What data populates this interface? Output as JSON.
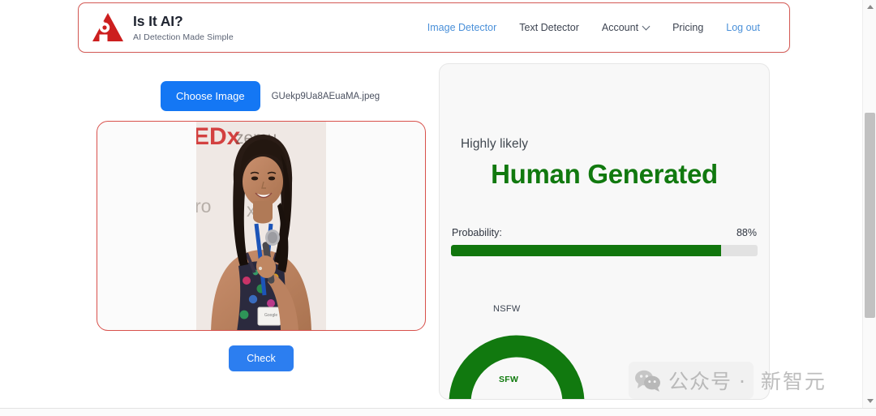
{
  "header": {
    "brand_title": "Is It AI?",
    "brand_tagline": "AI Detection Made Simple",
    "logo_icon": "red-triangle-robot-logo",
    "border_color": "#d45a55",
    "nav": [
      {
        "label": "Image Detector",
        "active": true,
        "icon": ""
      },
      {
        "label": "Text Detector",
        "active": false,
        "icon": ""
      },
      {
        "label": "Account",
        "active": false,
        "icon": "chevron-down-icon"
      },
      {
        "label": "Pricing",
        "active": false,
        "icon": ""
      },
      {
        "label": "Log out",
        "active": true,
        "icon": ""
      }
    ]
  },
  "upload": {
    "choose_button_label": "Choose Image",
    "file_name": "GUekp9Ua8AEuaMA.jpeg",
    "check_button_label": "Check",
    "preview_alt": "Smiling woman holding a microphone on a TEDx stage",
    "preview_border_color": "#d8504b",
    "button_color": "#1477f4"
  },
  "result": {
    "likelihood_text": "Highly likely",
    "verdict": "Human Generated",
    "verdict_color": "#11790f",
    "probability_label": "Probability:",
    "probability_value": "88%",
    "probability_percent": 88,
    "gauge": {
      "top_label": "NSFW",
      "bottom_label": "SFW",
      "arc_color": "#11790f",
      "value_label": "SFW"
    }
  },
  "watermark": {
    "icon": "wechat-icon",
    "text": "公众号 ·",
    "text_2": "新智元"
  },
  "scrollbar": {
    "up_icon": "triangle-up-icon",
    "down_icon": "triangle-down-icon",
    "thumb": "vertical-scroll-thumb"
  }
}
